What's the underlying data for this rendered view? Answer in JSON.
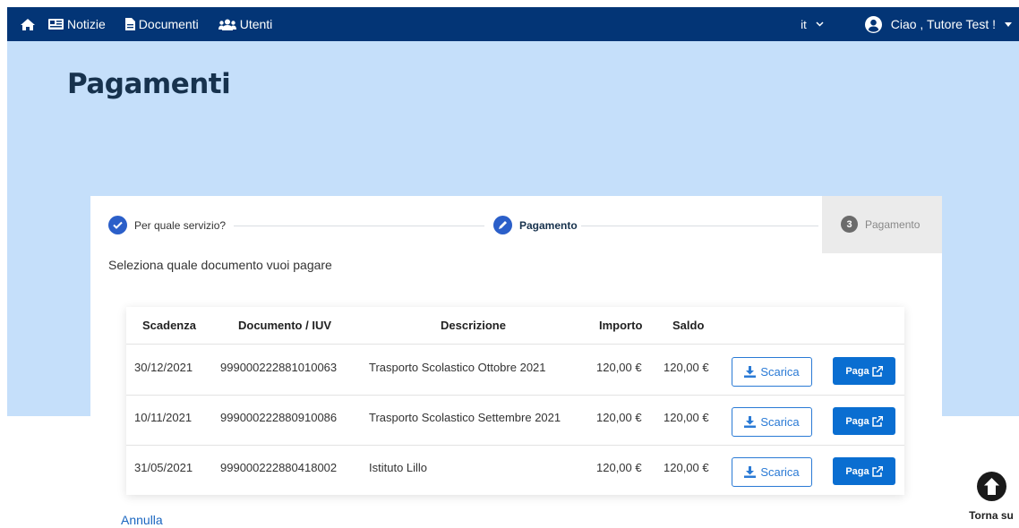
{
  "nav": {
    "items": [
      {
        "label": "Notizie",
        "icon": "newspaper-icon"
      },
      {
        "label": "Documenti",
        "icon": "document-icon"
      },
      {
        "label": "Utenti",
        "icon": "users-icon"
      }
    ],
    "language": "it",
    "greeting": "Ciao , Tutore Test !"
  },
  "page": {
    "title": "Pagamenti"
  },
  "stepper": {
    "steps": [
      {
        "label": "Per quale servizio?",
        "state": "completed"
      },
      {
        "label": "Pagamento",
        "state": "active"
      },
      {
        "label": "Pagamento",
        "state": "pending",
        "number": "3"
      }
    ]
  },
  "subtitle": "Seleziona quale documento vuoi pagare",
  "table": {
    "headers": [
      "Scadenza",
      "Documento / IUV",
      "Descrizione",
      "Importo",
      "Saldo"
    ],
    "rows": [
      {
        "scadenza": "30/12/2021",
        "documento": "999000222881010063",
        "descrizione": "Trasporto Scolastico Ottobre 2021",
        "importo": "120,00 €",
        "saldo": "120,00 €"
      },
      {
        "scadenza": "10/11/2021",
        "documento": "999000222880910086",
        "descrizione": "Trasporto Scolastico Settembre 2021",
        "importo": "120,00 €",
        "saldo": "120,00 €"
      },
      {
        "scadenza": "31/05/2021",
        "documento": "999000222880418002",
        "descrizione": "Istituto Lillo",
        "importo": "120,00 €",
        "saldo": "120,00 €"
      }
    ],
    "download_label": "Scarica",
    "pay_label": "Paga"
  },
  "cancel_label": "Annulla",
  "back_to_top_label": "Torna su",
  "colors": {
    "navbar": "#033576",
    "hero": "#c5dffa",
    "primary": "#0a6ed1",
    "step_active": "#2b5fc9"
  }
}
